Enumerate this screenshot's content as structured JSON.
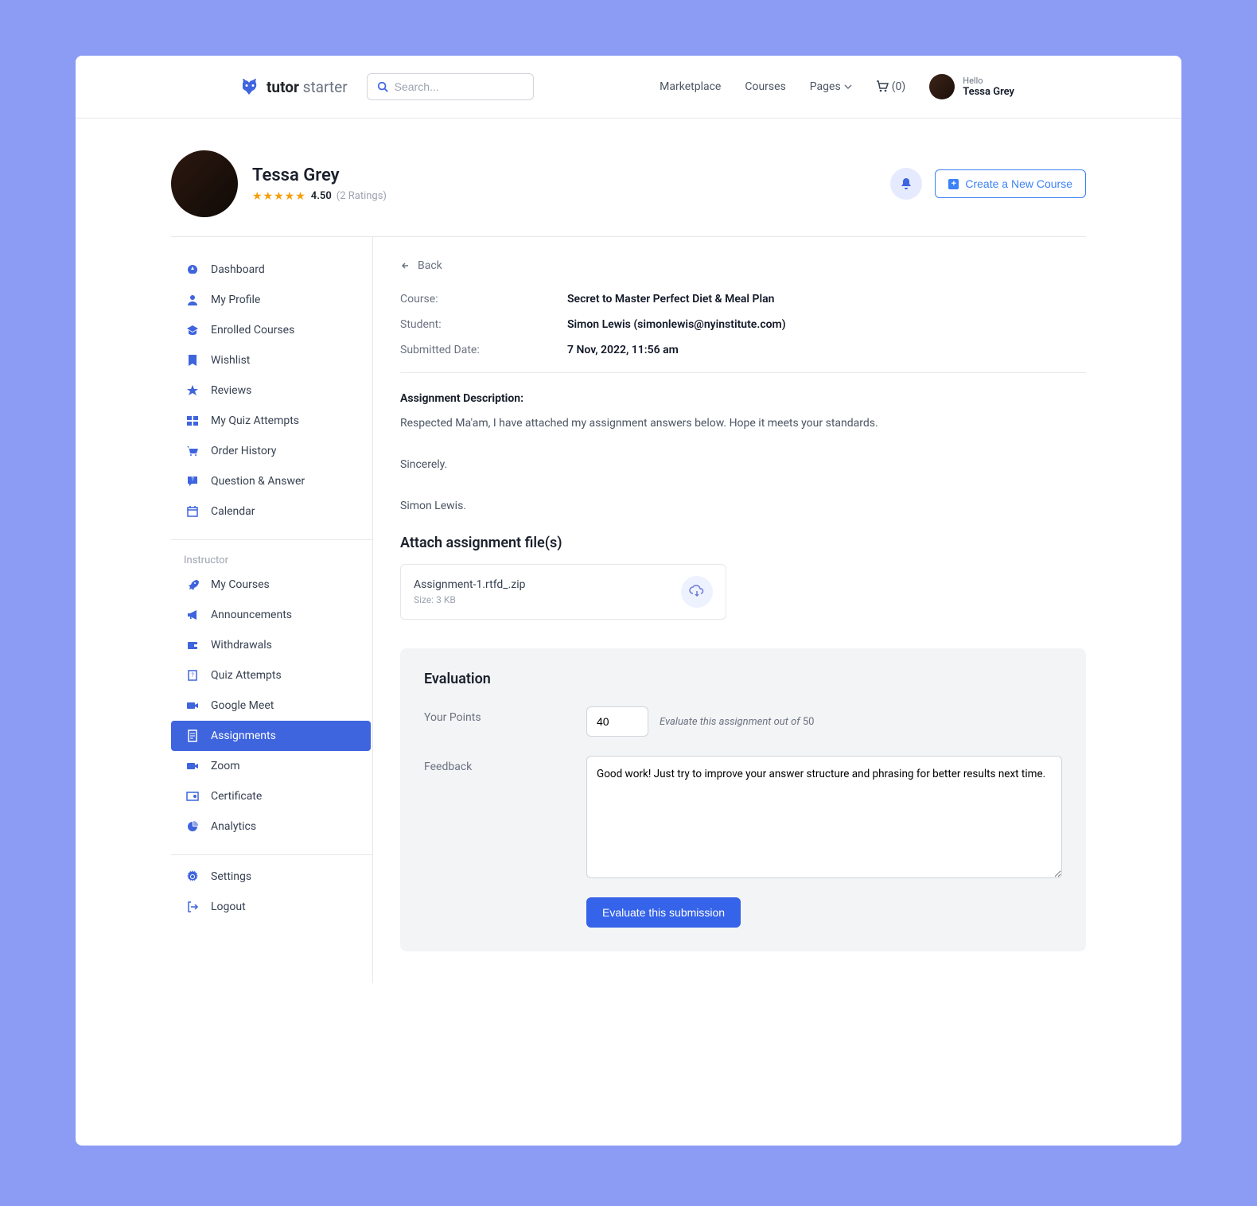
{
  "brand": {
    "bold": "tutor",
    "light": " starter"
  },
  "search_placeholder": "Search...",
  "topnav": {
    "marketplace": "Marketplace",
    "courses": "Courses",
    "pages": "Pages",
    "cart": "(0)"
  },
  "user": {
    "hello": "Hello",
    "name": "Tessa Grey",
    "rating_value": "4.50",
    "rating_count": "(2 Ratings)"
  },
  "actions": {
    "create_course": "Create a New Course"
  },
  "sidebar": {
    "main": [
      "Dashboard",
      "My Profile",
      "Enrolled Courses",
      "Wishlist",
      "Reviews",
      "My Quiz Attempts",
      "Order History",
      "Question & Answer",
      "Calendar"
    ],
    "instructor_heading": "Instructor",
    "instructor": [
      "My Courses",
      "Announcements",
      "Withdrawals",
      "Quiz Attempts",
      "Google Meet",
      "Assignments",
      "Zoom",
      "Certificate",
      "Analytics"
    ],
    "footer": [
      "Settings",
      "Logout"
    ]
  },
  "back_label": "Back",
  "meta": {
    "course_label": "Course:",
    "course_value": "Secret to Master Perfect Diet & Meal Plan",
    "student_label": "Student:",
    "student_value": "Simon Lewis (simonlewis@nyinstitute.com)",
    "date_label": "Submitted Date:",
    "date_value": "7 Nov, 2022, 11:56 am"
  },
  "description": {
    "heading": "Assignment Description:",
    "body": "Respected Ma'am, I have attached my assignment answers below. Hope it meets your standards.",
    "closing": "Sincerely.",
    "sig": "Simon Lewis."
  },
  "attach": {
    "heading": "Attach assignment file(s)",
    "file_name": "Assignment-1.rtfd_.zip",
    "file_size": "Size: 3 KB"
  },
  "evaluation": {
    "title": "Evaluation",
    "points_label": "Your Points",
    "points_value": "40",
    "hint_text": "Evaluate this assignment out of ",
    "hint_max": "50",
    "feedback_label": "Feedback",
    "feedback_value": "Good work! Just try to improve your answer structure and phrasing for better results next time.",
    "submit_label": "Evaluate this submission"
  }
}
